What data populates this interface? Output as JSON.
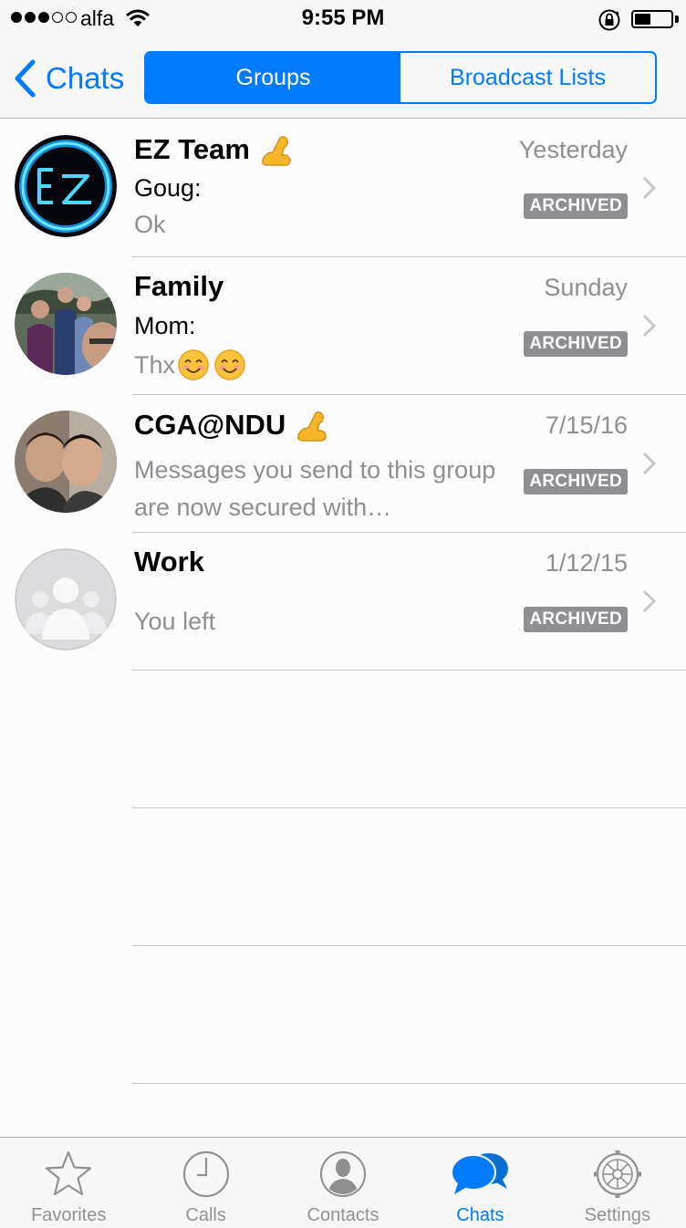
{
  "status_bar": {
    "carrier": "alfa",
    "time": "9:55 PM",
    "signal_bars_filled": 3,
    "signal_bars_total": 5,
    "battery_level": 0.45
  },
  "nav": {
    "back_label": "Chats",
    "segments": [
      "Groups",
      "Broadcast Lists"
    ],
    "active_segment": "Groups"
  },
  "chats": [
    {
      "name": "EZ Team",
      "sender": "Goug:",
      "preview": "Ok",
      "date": "Yesterday",
      "badge": "ARCHIVED",
      "emoji": "flexed-biceps"
    },
    {
      "name": "Family",
      "sender": "Mom:",
      "preview": "Thx",
      "date": "Sunday",
      "badge": "ARCHIVED",
      "emoji": "smiling-face"
    },
    {
      "name": "CGA@NDU",
      "sender": "",
      "preview": "Messages you send to this group are now secured with…",
      "date": "7/15/16",
      "badge": "ARCHIVED",
      "emoji": "flexed-biceps"
    },
    {
      "name": "Work",
      "sender": "",
      "preview": "You left",
      "date": "1/12/15",
      "badge": "ARCHIVED"
    }
  ],
  "tabs": [
    {
      "label": "Favorites",
      "icon": "star-icon"
    },
    {
      "label": "Calls",
      "icon": "clock-icon"
    },
    {
      "label": "Contacts",
      "icon": "person-icon"
    },
    {
      "label": "Chats",
      "icon": "chat-bubbles-icon",
      "active": true
    },
    {
      "label": "Settings",
      "icon": "gear-icon"
    }
  ],
  "colors": {
    "accent": "#007aff",
    "badge": "#8e8e93",
    "secondary_text": "#8e8e93",
    "tab_inactive": "#929292"
  }
}
